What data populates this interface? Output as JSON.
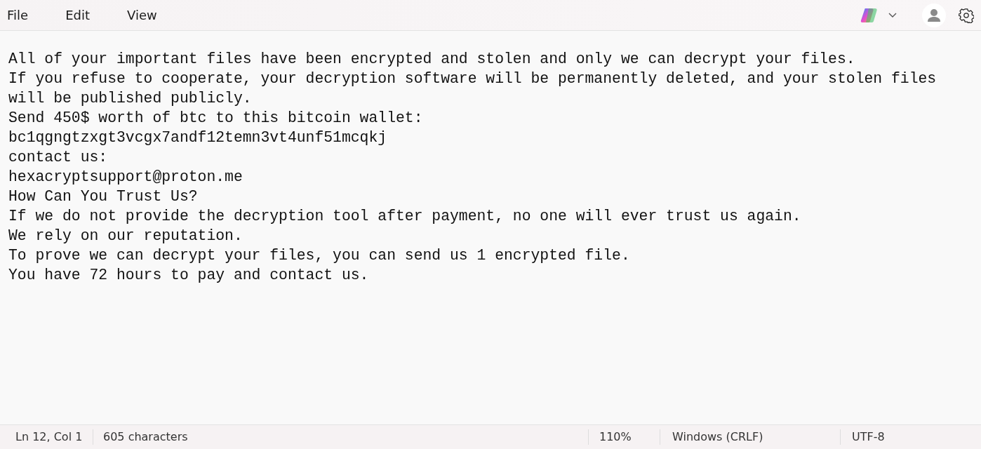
{
  "menu": [
    "File",
    "Edit",
    "View"
  ],
  "lines": [
    "All of your important files have been encrypted and stolen and only we can decrypt your files.",
    "If you refuse to cooperate, your decryption software will be permanently deleted, and your stolen files will be published publicly.",
    "Send 450$ worth of btc to this bitcoin wallet:",
    "bc1qgngtzxgt3vcgx7andf12temn3vt4unf51mcqkj",
    "contact us:",
    "hexacryptsupport@proton.me",
    "How Can You Trust Us?",
    "If we do not provide the decryption tool after payment, no one will ever trust us again.",
    "We rely on our reputation.",
    "To prove we can decrypt your files, you can send us 1 encrypted file.",
    "You have 72 hours to pay and contact us."
  ],
  "status_bar": {
    "position": "Ln 12, Col 1",
    "characters": "605 characters",
    "zoom": "110%",
    "line_ending": "Windows (CRLF)",
    "encoding": "UTF-8"
  }
}
